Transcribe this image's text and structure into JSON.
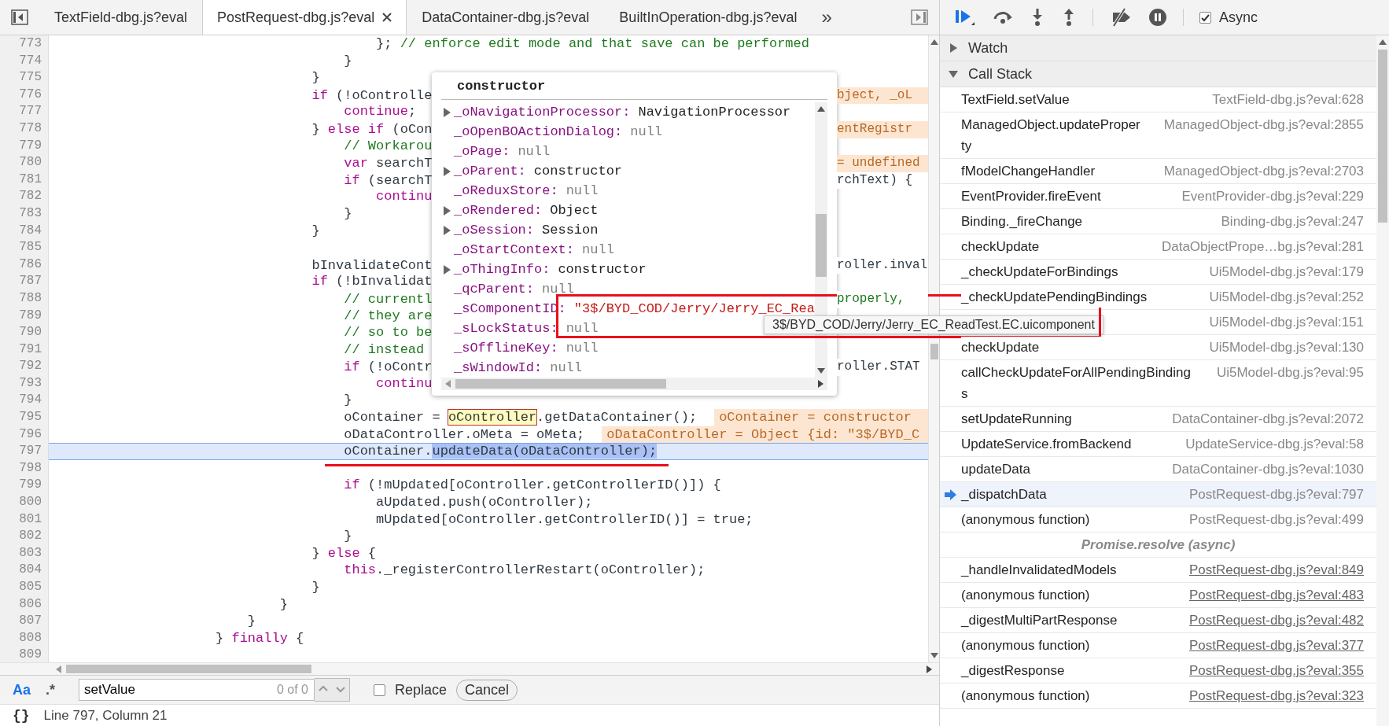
{
  "tab_bar": {
    "tabs": [
      {
        "label": "TextField-dbg.js?eval",
        "selected": false
      },
      {
        "label": "PostRequest-dbg.js?eval",
        "selected": true
      },
      {
        "label": "DataContainer-dbg.js?eval",
        "selected": false
      },
      {
        "label": "BuiltInOperation-dbg.js?eval",
        "selected": false
      }
    ],
    "overflow": "»"
  },
  "editor": {
    "lines": [
      {
        "number": "773",
        "current": false,
        "code": [
          {
            "kind": "plain",
            "text": "                                        }; "
          },
          {
            "kind": "comment",
            "text": "// enforce edit mode and that save can be performed"
          }
        ]
      },
      {
        "number": "774",
        "current": false,
        "code": [
          {
            "kind": "plain",
            "text": "                                    }"
          }
        ]
      },
      {
        "number": "775",
        "current": false,
        "code": [
          {
            "kind": "plain",
            "text": "                                }"
          }
        ]
      },
      {
        "number": "776",
        "current": false,
        "code": [
          {
            "kind": "keyword",
            "text": "                                if"
          },
          {
            "kind": "plain",
            "text": " (!oControlle"
          }
        ],
        "right": {
          "kind": "inline_value",
          "text": "bject, _oL"
        }
      },
      {
        "number": "777",
        "current": false,
        "code": [
          {
            "kind": "keyword",
            "text": "                                    continue"
          },
          {
            "kind": "plain",
            "text": ";"
          }
        ]
      },
      {
        "number": "778",
        "current": false,
        "code": [
          {
            "kind": "plain",
            "text": "                                } "
          },
          {
            "kind": "keyword",
            "text": "else if"
          },
          {
            "kind": "plain",
            "text": " (oCon"
          }
        ],
        "right": {
          "kind": "inline_value",
          "text": "entRegistr"
        }
      },
      {
        "number": "779",
        "current": false,
        "code": [
          {
            "kind": "comment",
            "text": "                                    // Workarou"
          }
        ]
      },
      {
        "number": "780",
        "current": false,
        "code": [
          {
            "kind": "keyword",
            "text": "                                    var"
          },
          {
            "kind": "plain",
            "text": " searchT"
          }
        ],
        "right": {
          "kind": "inline_value",
          "text": "= undefined"
        }
      },
      {
        "number": "781",
        "current": false,
        "code": [
          {
            "kind": "keyword",
            "text": "                                    if"
          },
          {
            "kind": "plain",
            "text": " (searchT"
          }
        ],
        "right": {
          "kind": "plain",
          "text": "rchText) {"
        }
      },
      {
        "number": "782",
        "current": false,
        "code": [
          {
            "kind": "keyword",
            "text": "                                        continu"
          }
        ]
      },
      {
        "number": "783",
        "current": false,
        "code": [
          {
            "kind": "plain",
            "text": "                                    }"
          }
        ]
      },
      {
        "number": "784",
        "current": false,
        "code": [
          {
            "kind": "plain",
            "text": "                                }"
          }
        ]
      },
      {
        "number": "785",
        "current": false
      },
      {
        "number": "786",
        "current": false,
        "code": [
          {
            "kind": "plain",
            "text": "                                bInvalidateCont"
          }
        ],
        "right": {
          "kind": "plain",
          "text": "roller.inval"
        }
      },
      {
        "number": "787",
        "current": false,
        "code": [
          {
            "kind": "keyword",
            "text": "                                if"
          },
          {
            "kind": "plain",
            "text": " (!bInvalidat"
          }
        ]
      },
      {
        "number": "788",
        "current": false,
        "code": [
          {
            "kind": "comment",
            "text": "                                    // currentl"
          }
        ],
        "right": {
          "kind": "comment",
          "text": "properly,"
        }
      },
      {
        "number": "789",
        "current": false,
        "code": [
          {
            "kind": "comment",
            "text": "                                    // they are"
          }
        ]
      },
      {
        "number": "790",
        "current": false,
        "code": [
          {
            "kind": "comment",
            "text": "                                    // so to be"
          }
        ]
      },
      {
        "number": "791",
        "current": false,
        "code": [
          {
            "kind": "comment",
            "text": "                                    // instead"
          }
        ]
      },
      {
        "number": "792",
        "current": false,
        "code": [
          {
            "kind": "keyword",
            "text": "                                    if"
          },
          {
            "kind": "plain",
            "text": " (!oContr"
          }
        ],
        "right": {
          "kind": "plain",
          "text": "roller.STAT"
        }
      },
      {
        "number": "793",
        "current": false,
        "code": [
          {
            "kind": "keyword",
            "text": "                                        continu"
          }
        ]
      },
      {
        "number": "794",
        "current": false,
        "code": [
          {
            "kind": "plain",
            "text": "                                    }"
          }
        ]
      },
      {
        "number": "795",
        "current": false,
        "code": [
          {
            "kind": "plain",
            "text": "                                    oContainer = "
          },
          {
            "kind": "highlight",
            "text": "oController"
          },
          {
            "kind": "plain",
            "text": ".getDataContainer();"
          }
        ],
        "inline": {
          "text": "oContainer = constructor"
        }
      },
      {
        "number": "796",
        "current": false,
        "code": [
          {
            "kind": "plain",
            "text": "                                    oDataController.oMeta = oMeta;"
          }
        ],
        "inline": {
          "text": "oDataController = Object {id: \"3$/BYD_C"
        }
      },
      {
        "number": "797",
        "current": true,
        "code": [
          {
            "kind": "plain",
            "text": "                                    oContainer."
          },
          {
            "kind": "selection",
            "text": "updateData(oDataController);"
          }
        ]
      },
      {
        "number": "798",
        "current": false
      },
      {
        "number": "799",
        "current": false,
        "code": [
          {
            "kind": "keyword",
            "text": "                                    if"
          },
          {
            "kind": "plain",
            "text": " (!mUpdated[oController.getControllerID()]) {"
          }
        ]
      },
      {
        "number": "800",
        "current": false,
        "code": [
          {
            "kind": "plain",
            "text": "                                        aUpdated.push(oController);"
          }
        ]
      },
      {
        "number": "801",
        "current": false,
        "code": [
          {
            "kind": "plain",
            "text": "                                        mUpdated[oController.getControllerID()] = true;"
          }
        ]
      },
      {
        "number": "802",
        "current": false,
        "code": [
          {
            "kind": "plain",
            "text": "                                    }"
          }
        ]
      },
      {
        "number": "803",
        "current": false,
        "code": [
          {
            "kind": "plain",
            "text": "                                } "
          },
          {
            "kind": "keyword",
            "text": "else"
          },
          {
            "kind": "plain",
            "text": " {"
          }
        ]
      },
      {
        "number": "804",
        "current": false,
        "code": [
          {
            "kind": "keyword",
            "text": "                                    this"
          },
          {
            "kind": "plain",
            "text": "._registerControllerRestart(oController);"
          }
        ]
      },
      {
        "number": "805",
        "current": false,
        "code": [
          {
            "kind": "plain",
            "text": "                                }"
          }
        ]
      },
      {
        "number": "806",
        "current": false,
        "code": [
          {
            "kind": "plain",
            "text": "                            }"
          }
        ]
      },
      {
        "number": "807",
        "current": false,
        "code": [
          {
            "kind": "plain",
            "text": "                        }"
          }
        ]
      },
      {
        "number": "808",
        "current": false,
        "code": [
          {
            "kind": "plain",
            "text": "                    } "
          },
          {
            "kind": "keyword",
            "text": "finally"
          },
          {
            "kind": "plain",
            "text": " {"
          }
        ]
      },
      {
        "number": "809",
        "current": false
      }
    ]
  },
  "popover": {
    "title": "constructor",
    "properties": [
      {
        "name": "_oNavigationProcessor:",
        "value": "NavigationProcessor",
        "kind": "object",
        "expandable": true
      },
      {
        "name": "_oOpenBOActionDialog:",
        "value": "null",
        "kind": "null",
        "expandable": false
      },
      {
        "name": "_oPage:",
        "value": "null",
        "kind": "null",
        "expandable": false
      },
      {
        "name": "_oParent:",
        "value": "constructor",
        "kind": "object",
        "expandable": true
      },
      {
        "name": "_oReduxStore:",
        "value": "null",
        "kind": "null",
        "expandable": false
      },
      {
        "name": "_oRendered:",
        "value": "Object",
        "kind": "object",
        "expandable": true
      },
      {
        "name": "_oSession:",
        "value": "Session",
        "kind": "object",
        "expandable": true
      },
      {
        "name": "_oStartContext:",
        "value": "null",
        "kind": "null",
        "expandable": false
      },
      {
        "name": "_oThingInfo:",
        "value": "constructor",
        "kind": "object",
        "expandable": true
      },
      {
        "name": "_qcParent:",
        "value": "null",
        "kind": "null",
        "expandable": false
      },
      {
        "name": "_sComponentID:",
        "value": "\"3$/BYD_COD/Jerry/Jerry_EC_Rea",
        "kind": "string",
        "expandable": false
      },
      {
        "name": "_sLockStatus:",
        "value": "null",
        "kind": "null",
        "expandable": false
      },
      {
        "name": "_sOfflineKey:",
        "value": "null",
        "kind": "null",
        "expandable": false
      },
      {
        "name": "_sWindowId:",
        "value": "null",
        "kind": "null",
        "expandable": false
      }
    ]
  },
  "tooltip": {
    "text": "3$/BYD_COD/Jerry/Jerry_EC_ReadTest.EC.uicomponent"
  },
  "search_bar": {
    "match_case": {
      "label": "Aa",
      "on": true
    },
    "regex": {
      "label": ".*",
      "on": false
    },
    "value": "setValue",
    "count": "0 of 0",
    "replace": {
      "label": "Replace",
      "checked": false
    },
    "cancel": "Cancel"
  },
  "status_bar": {
    "pretty_print": "{}",
    "position": "Line 797, Column 21"
  },
  "debugger": {
    "async": {
      "label": "Async",
      "checked": true
    },
    "watch": {
      "title": "Watch",
      "expanded": false
    },
    "call_stack": {
      "title": "Call Stack",
      "expanded": true,
      "frames": [
        {
          "kind": "frame",
          "name": "TextField.setValue",
          "location": "TextField-dbg.js?eval:628",
          "selected": false,
          "linked": false
        },
        {
          "kind": "frame",
          "name": "ManagedObject.updateProperty",
          "location": "ManagedObject-dbg.js?eval:2855",
          "selected": false,
          "linked": false
        },
        {
          "kind": "frame",
          "name": "fModelChangeHandler",
          "location": "ManagedObject-dbg.js?eval:2703",
          "selected": false,
          "linked": false
        },
        {
          "kind": "frame",
          "name": "EventProvider.fireEvent",
          "location": "EventProvider-dbg.js?eval:229",
          "selected": false,
          "linked": false
        },
        {
          "kind": "frame",
          "name": "Binding._fireChange",
          "location": "Binding-dbg.js?eval:247",
          "selected": false,
          "linked": false
        },
        {
          "kind": "frame",
          "name": "checkUpdate",
          "location": "DataObjectPrope…bg.js?eval:281",
          "selected": false,
          "linked": false
        },
        {
          "kind": "frame",
          "name": "_checkUpdateForBindings",
          "location": "Ui5Model-dbg.js?eval:179",
          "selected": false,
          "linked": false
        },
        {
          "kind": "frame",
          "name": "_checkUpdatePendingBindings",
          "location": "Ui5Model-dbg.js?eval:252",
          "selected": false,
          "linked": false
        },
        {
          "kind": "frame",
          "location": "Ui5Model-dbg.js?eval:151",
          "selected": false,
          "linked": false
        },
        {
          "kind": "frame",
          "name": "checkUpdate",
          "location": "Ui5Model-dbg.js?eval:130",
          "selected": false,
          "linked": false
        },
        {
          "kind": "frame",
          "name": "callCheckUpdateForAllPendingBindings",
          "location": "Ui5Model-dbg.js?eval:95",
          "selected": false,
          "linked": false
        },
        {
          "kind": "frame",
          "name": "setUpdateRunning",
          "location": "DataContainer-dbg.js?eval:2072",
          "selected": false,
          "linked": false
        },
        {
          "kind": "frame",
          "name": "UpdateService.fromBackend",
          "location": "UpdateService-dbg.js?eval:58",
          "selected": false,
          "linked": false
        },
        {
          "kind": "frame",
          "name": "updateData",
          "location": "DataContainer-dbg.js?eval:1030",
          "selected": false,
          "linked": false
        },
        {
          "kind": "frame",
          "name": "_dispatchData",
          "location": "PostRequest-dbg.js?eval:797",
          "selected": true,
          "linked": false
        },
        {
          "kind": "frame",
          "name": "(anonymous function)",
          "location": "PostRequest-dbg.js?eval:499",
          "selected": false,
          "linked": false
        },
        {
          "kind": "async",
          "label": "Promise.resolve (async)"
        },
        {
          "kind": "frame",
          "name": "_handleInvalidatedModels",
          "location": "PostRequest-dbg.js?eval:849",
          "selected": false,
          "linked": true
        },
        {
          "kind": "frame",
          "name": "(anonymous function)",
          "location": "PostRequest-dbg.js?eval:483",
          "selected": false,
          "linked": true
        },
        {
          "kind": "frame",
          "name": "_digestMultiPartResponse",
          "location": "PostRequest-dbg.js?eval:482",
          "selected": false,
          "linked": true
        },
        {
          "kind": "frame",
          "name": "(anonymous function)",
          "location": "PostRequest-dbg.js?eval:377",
          "selected": false,
          "linked": true
        },
        {
          "kind": "frame",
          "name": "_digestResponse",
          "location": "PostRequest-dbg.js?eval:355",
          "selected": false,
          "linked": true
        },
        {
          "kind": "frame",
          "name": "(anonymous function)",
          "location": "PostRequest-dbg.js?eval:323",
          "selected": false,
          "linked": true
        }
      ]
    }
  }
}
